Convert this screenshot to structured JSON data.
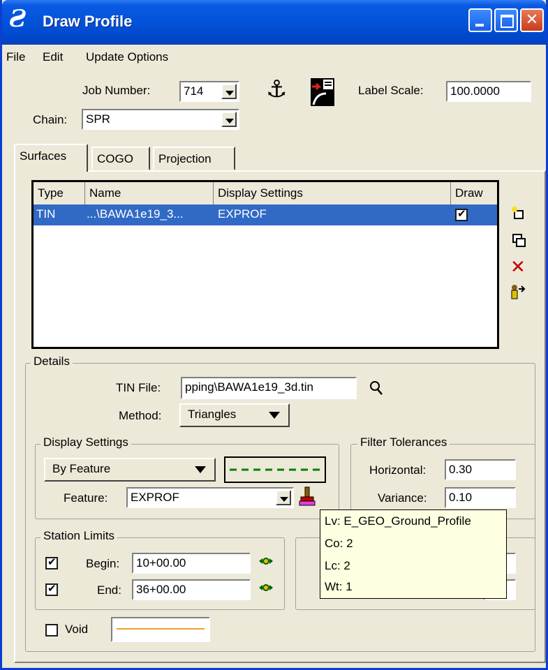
{
  "window": {
    "title": "Draw Profile"
  },
  "menu": [
    "File",
    "Edit",
    "Update Options"
  ],
  "header": {
    "job_number_label": "Job Number:",
    "job_number_value": "714",
    "label_scale_label": "Label Scale:",
    "label_scale_value": "100.0000",
    "chain_label": "Chain:",
    "chain_value": "SPR"
  },
  "tabs": [
    "Surfaces",
    "COGO",
    "Projection"
  ],
  "surfaces_table": {
    "columns": [
      "Type",
      "Name",
      "Display Settings",
      "Draw"
    ],
    "rows": [
      {
        "type": "TIN",
        "name": "...\\BAWA1e19_3...",
        "display_settings": "EXPROF",
        "draw": true
      }
    ]
  },
  "details": {
    "title": "Details",
    "tin_file_label": "TIN File:",
    "tin_file_value": "pping\\BAWA1e19_3d.tin",
    "method_label": "Method:",
    "method_value": "Triangles"
  },
  "display_settings": {
    "title": "Display Settings",
    "mode": "By Feature",
    "feature_label": "Feature:",
    "feature_value": "EXPROF",
    "line_color": "#008000"
  },
  "filter_tolerances": {
    "title": "Filter Tolerances",
    "horizontal_label": "Horizontal:",
    "horizontal_value": "0.30",
    "variance_label": "Variance:",
    "variance_value": "0.10"
  },
  "station_limits": {
    "title": "Station Limits",
    "begin_label": "Begin:",
    "begin_value": "10+00.00",
    "begin_checked": true,
    "end_label": "End:",
    "end_value": "36+00.00",
    "end_checked": true
  },
  "void": {
    "label": "Void",
    "checked": false,
    "line_color": "#f0a030"
  },
  "tooltip": {
    "lines": [
      "Lv: E_GEO_Ground_Profile",
      "Co: 2",
      "Lc: 2",
      "Wt: 1"
    ]
  },
  "colors": {
    "titlebar": "#0253d9",
    "selection": "#316ac5",
    "window_bg": "#ece9d8"
  }
}
